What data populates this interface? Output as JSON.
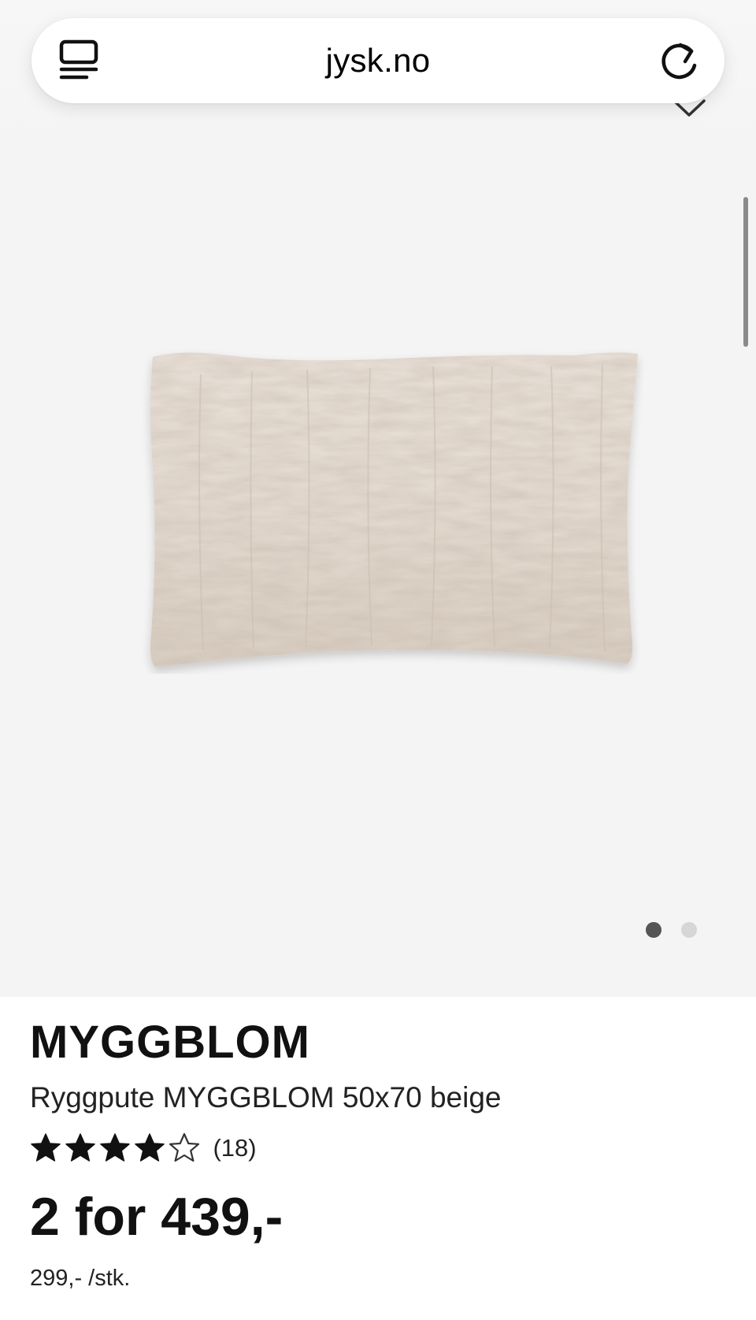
{
  "browser": {
    "url": "jysk.no",
    "tabs_icon": "tabs-icon",
    "reload_icon": "reload-icon"
  },
  "gallery": {
    "image_description": "Beige faux fur cushion",
    "background_color": "#f4f4f4",
    "favorite_icon": "chevron-down-icon",
    "current_image": 1,
    "total_images": 2
  },
  "product": {
    "brand": "MYGGBLOM",
    "name": "Ryggpute MYGGBLOM 50x70 beige",
    "rating": 4,
    "max_rating": 5,
    "review_count": "(18)",
    "price": "2 for 439,-",
    "unit_price": "299,- /stk."
  },
  "colors": {
    "text": "#111111",
    "star": "#111111",
    "dot_active": "#555555",
    "dot_inactive": "#d6d6d6"
  }
}
